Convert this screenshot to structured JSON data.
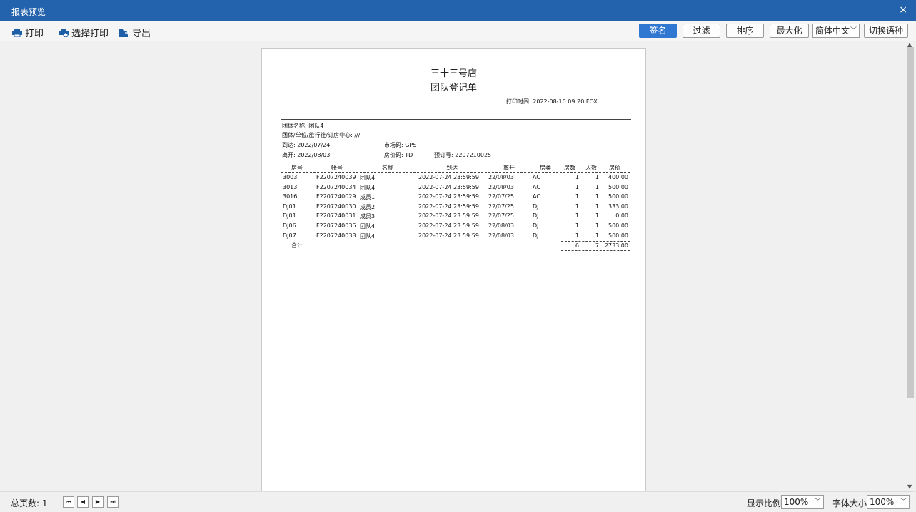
{
  "window": {
    "title": "报表预览",
    "close_glyph": "×"
  },
  "toolbar": {
    "print_label": "打印",
    "select_print_label": "选择打印",
    "export_label": "导出",
    "sign_label": "签名",
    "filter_label": "过滤",
    "sort_label": "排序",
    "maximize_label": "最大化",
    "language_value": "简体中文",
    "switch_language_label": "切换语种"
  },
  "report": {
    "hotel": "三十三号店",
    "title": "团队登记单",
    "print_time": "打印时间: 2022-08-10 09:20 FOX",
    "group_name": "团体名称: 团队4",
    "group_unit": "团体/单位/旅行社/订房中心: ///",
    "arrival": "到达: 2022/07/24",
    "market_code": "市场码: GPS",
    "departure": "离开: 2022/08/03",
    "rate_code": "房价码: TD",
    "booking_no": "预订号: 2207210025",
    "columns": [
      "房号",
      "帐号",
      "名称",
      "到达",
      "离开",
      "房类",
      "房数",
      "人数",
      "房价"
    ],
    "rows": [
      [
        "3003",
        "F2207240039",
        "团队4",
        "2022-07-24 23:59:59",
        "22/08/03",
        "AC",
        "1",
        "1",
        "400.00"
      ],
      [
        "3013",
        "F2207240034",
        "团队4",
        "2022-07-24 23:59:59",
        "22/08/03",
        "AC",
        "1",
        "1",
        "500.00"
      ],
      [
        "3016",
        "F2207240029",
        "成员1",
        "2022-07-24 23:59:59",
        "22/07/25",
        "AC",
        "1",
        "1",
        "500.00"
      ],
      [
        "DJ01",
        "F2207240030",
        "成员2",
        "2022-07-24 23:59:59",
        "22/07/25",
        "DJ",
        "1",
        "1",
        "333.00"
      ],
      [
        "DJ01",
        "F2207240031",
        "成员3",
        "2022-07-24 23:59:59",
        "22/07/25",
        "DJ",
        "1",
        "1",
        "0.00"
      ],
      [
        "DJ06",
        "F2207240036",
        "团队4",
        "2022-07-24 23:59:59",
        "22/08/03",
        "DJ",
        "1",
        "1",
        "500.00"
      ],
      [
        "DJ07",
        "F2207240038",
        "团队4",
        "2022-07-24 23:59:59",
        "22/08/03",
        "DJ",
        "1",
        "1",
        "500.00"
      ]
    ],
    "total_label": "合计",
    "total_rooms": "6",
    "total_persons": "7",
    "total_price": "2733.00"
  },
  "statusbar": {
    "total_pages": "总页数: 1",
    "display_ratio_label": "显示比例",
    "display_ratio_value": "100%",
    "font_size_label": "字体大小",
    "font_size_value": "100%"
  },
  "colors": {
    "titlebar": "#2362ac",
    "primary_button": "#2f77d0"
  }
}
